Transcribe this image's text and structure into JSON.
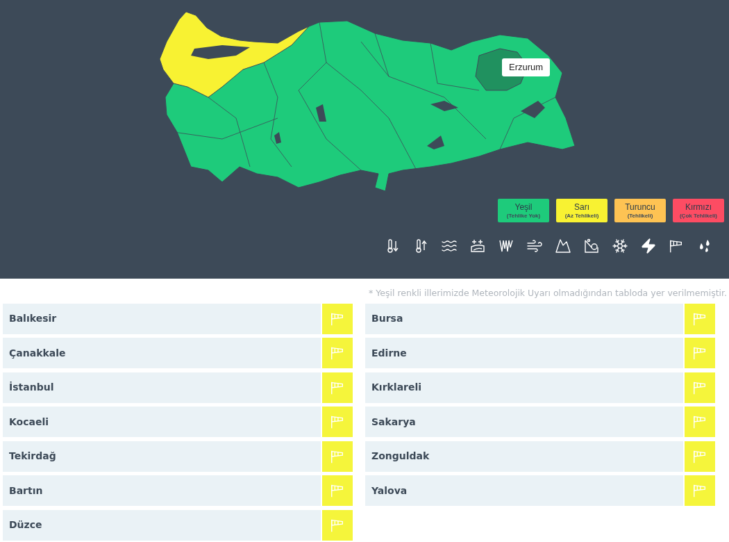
{
  "map": {
    "tooltip": "Erzurum"
  },
  "legend": [
    {
      "label": "Yeşil",
      "sublabel": "(Tehlike Yok)",
      "color": "#1ecb7b"
    },
    {
      "label": "Sarı",
      "sublabel": "(Az Tehlikeli)",
      "color": "#f8f232"
    },
    {
      "label": "Turuncu",
      "sublabel": "(Tehlikeli)",
      "color": "#fec353"
    },
    {
      "label": "Kırmızı",
      "sublabel": "(Çok Tehlikeli)",
      "color": "#fd4c63"
    }
  ],
  "note": "* Yeşil renkli illerimizde Meteorolojik Uyarı olmadığından tabloda yer verilmemiştir.",
  "warnings": {
    "left": [
      {
        "province": "Balıkesir",
        "color": "#f5f53b"
      },
      {
        "province": "Çanakkale",
        "color": "#f5f53b"
      },
      {
        "province": "İstanbul",
        "color": "#f5f53b"
      },
      {
        "province": "Kocaeli",
        "color": "#f5f53b"
      },
      {
        "province": "Tekirdağ",
        "color": "#f5f53b"
      },
      {
        "province": "Bartın",
        "color": "#f5f53b"
      },
      {
        "province": "Düzce",
        "color": "#f5f53b"
      }
    ],
    "right": [
      {
        "province": "Bursa",
        "color": "#f5f53b"
      },
      {
        "province": "Edirne",
        "color": "#f5f53b"
      },
      {
        "province": "Kırklareli",
        "color": "#f5f53b"
      },
      {
        "province": "Sakarya",
        "color": "#f5f53b"
      },
      {
        "province": "Zonguldak",
        "color": "#f5f53b"
      },
      {
        "province": "Yalova",
        "color": "#f5f53b"
      }
    ]
  }
}
